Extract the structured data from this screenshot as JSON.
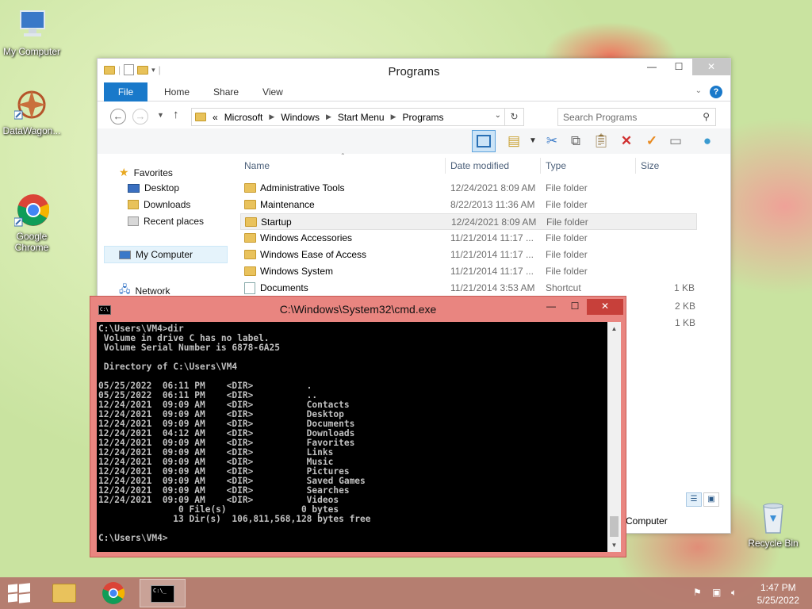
{
  "desktop": {
    "icons": [
      {
        "label": "My Computer"
      },
      {
        "label": "DataWagon..."
      },
      {
        "label": "Google\nChrome"
      },
      {
        "label": "Recycle Bin"
      }
    ]
  },
  "explorer": {
    "title": "Programs",
    "ribbon": {
      "file": "File",
      "home": "Home",
      "share": "Share",
      "view": "View"
    },
    "address": {
      "prefix": "«",
      "segments": [
        "Microsoft",
        "Windows",
        "Start Menu",
        "Programs"
      ]
    },
    "search_placeholder": "Search Programs",
    "nav": {
      "favorites": "Favorites",
      "desktop": "Desktop",
      "downloads": "Downloads",
      "recent": "Recent places",
      "my_computer": "My Computer",
      "network": "Network"
    },
    "columns": {
      "name": "Name",
      "date": "Date modified",
      "type": "Type",
      "size": "Size"
    },
    "rows": [
      {
        "name": "Administrative Tools",
        "date": "12/24/2021 8:09 AM",
        "type": "File folder",
        "size": ""
      },
      {
        "name": "Maintenance",
        "date": "8/22/2013 11:36 AM",
        "type": "File folder",
        "size": ""
      },
      {
        "name": "Startup",
        "date": "12/24/2021 8:09 AM",
        "type": "File folder",
        "size": ""
      },
      {
        "name": "Windows Accessories",
        "date": "11/21/2014 11:17 ...",
        "type": "File folder",
        "size": ""
      },
      {
        "name": "Windows Ease of Access",
        "date": "11/21/2014 11:17 ...",
        "type": "File folder",
        "size": ""
      },
      {
        "name": "Windows System",
        "date": "11/21/2014 11:17 ...",
        "type": "File folder",
        "size": ""
      },
      {
        "name": "Documents",
        "date": "11/21/2014 3:53 AM",
        "type": "Shortcut",
        "size": "1 KB"
      }
    ],
    "hidden_sizes": [
      "2 KB",
      "1 KB"
    ],
    "status_computer": "Computer"
  },
  "cmd": {
    "title": "C:\\Windows\\System32\\cmd.exe",
    "output": "C:\\Users\\VM4>dir\n Volume in drive C has no label.\n Volume Serial Number is 6878-6A25\n\n Directory of C:\\Users\\VM4\n\n05/25/2022  06:11 PM    <DIR>          .\n05/25/2022  06:11 PM    <DIR>          ..\n12/24/2021  09:09 AM    <DIR>          Contacts\n12/24/2021  09:09 AM    <DIR>          Desktop\n12/24/2021  09:09 AM    <DIR>          Documents\n12/24/2021  04:12 AM    <DIR>          Downloads\n12/24/2021  09:09 AM    <DIR>          Favorites\n12/24/2021  09:09 AM    <DIR>          Links\n12/24/2021  09:09 AM    <DIR>          Music\n12/24/2021  09:09 AM    <DIR>          Pictures\n12/24/2021  09:09 AM    <DIR>          Saved Games\n12/24/2021  09:09 AM    <DIR>          Searches\n12/24/2021  09:09 AM    <DIR>          Videos\n               0 File(s)              0 bytes\n              13 Dir(s)  106,811,568,128 bytes free\n\nC:\\Users\\VM4>"
  },
  "taskbar": {
    "time": "1:47 PM",
    "date": "5/25/2022"
  },
  "colors": {
    "accent": "#1979ca",
    "cmd_frame": "#e98580",
    "taskbar": "#b4786e"
  }
}
